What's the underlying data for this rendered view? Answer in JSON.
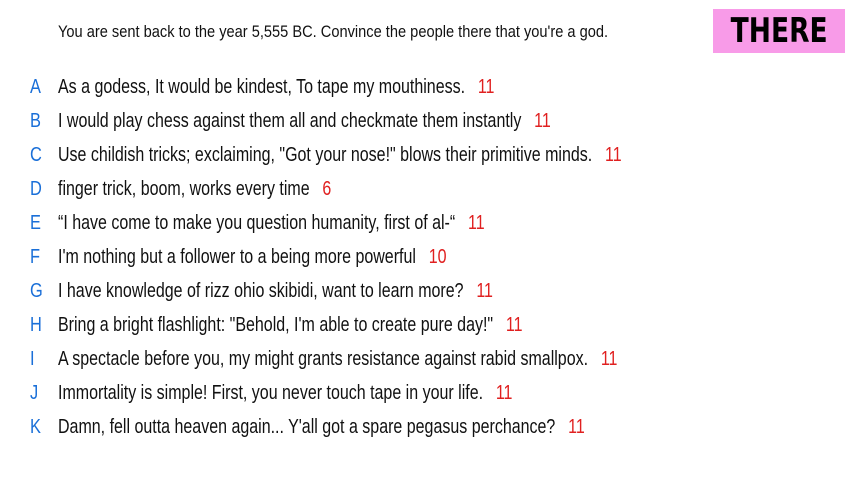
{
  "prompt": "You are sent back to the year 5,555 BC. Convince the people there that you're a god.",
  "badge": "THERE",
  "colors": {
    "letter": "#1a6fd8",
    "score": "#e02020",
    "badge_bg": "#f89be8"
  },
  "answers": [
    {
      "letter": "A",
      "text": "As a godess, It would be kindest, To tape my mouthiness.",
      "score": "11"
    },
    {
      "letter": "B",
      "text": "I would play chess against them all and checkmate them instantly",
      "score": "11"
    },
    {
      "letter": "C",
      "text": "Use childish tricks; exclaiming, \"Got your nose!\" blows their primitive minds.",
      "score": "11"
    },
    {
      "letter": "D",
      "text": "finger trick, boom, works every time",
      "score": "6"
    },
    {
      "letter": "E",
      "text": "“I have come to make you question humanity, first of al-“",
      "score": "11"
    },
    {
      "letter": "F",
      "text": "I'm nothing but a follower to a being more powerful",
      "score": "10"
    },
    {
      "letter": "G",
      "text": "I have knowledge of rizz ohio skibidi, want to learn more?",
      "score": "11"
    },
    {
      "letter": "H",
      "text": "Bring a bright flashlight: \"Behold, I'm able to create pure day!\"",
      "score": "11"
    },
    {
      "letter": "I",
      "text": "A spectacle before you, my might grants resistance against rabid smallpox.",
      "score": "11"
    },
    {
      "letter": "J",
      "text": "Immortality is simple! First, you never touch tape in your life.",
      "score": "11"
    },
    {
      "letter": "K",
      "text": "Damn, fell outta heaven again... Y'all got a spare pegasus perchance?",
      "score": "11"
    }
  ]
}
